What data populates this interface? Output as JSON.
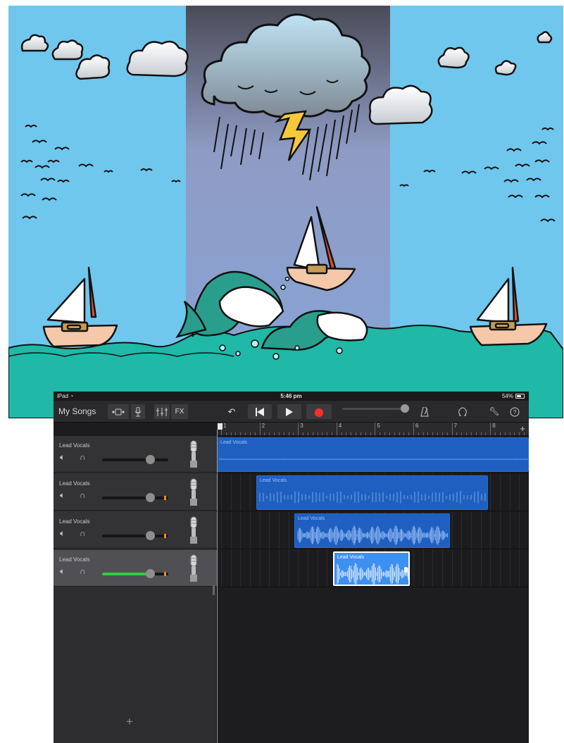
{
  "status_bar": {
    "device": "iPad",
    "wifi_icon": "wifi-icon",
    "time": "5:46 pm",
    "battery": "54%"
  },
  "toolbar": {
    "my_songs": "My Songs",
    "fx": "FX",
    "icons": [
      "browser-icon",
      "microphone-icon",
      "mixer-icon",
      "undo-icon",
      "rewind-icon",
      "play-icon",
      "record-icon",
      "metronome-icon",
      "loop-icon",
      "settings-wrench-icon",
      "help-icon"
    ]
  },
  "ruler": {
    "bars": [
      "1",
      "2",
      "3",
      "4",
      "5",
      "6",
      "7",
      "8"
    ],
    "add_label": "+"
  },
  "tracks": [
    {
      "name": "Lead Vocals",
      "volume": 0.72,
      "selected": false,
      "meter": false
    },
    {
      "name": "Lead Vocals",
      "volume": 0.72,
      "selected": false,
      "meter": true
    },
    {
      "name": "Lead Vocals",
      "volume": 0.72,
      "selected": false,
      "meter": true
    },
    {
      "name": "Lead Vocals",
      "volume": 0.72,
      "selected": true,
      "meter": true
    }
  ],
  "regions": [
    {
      "label": "Lead Vocals",
      "selected": false
    },
    {
      "label": "Lead Vocals",
      "selected": false
    },
    {
      "label": "Lead Vocals",
      "selected": false
    },
    {
      "label": "Lead Vocals",
      "selected": true
    }
  ],
  "add_track": "+",
  "colors": {
    "sky": "#6fc7ee",
    "storm_sky": "#7f95c4",
    "sea": "#20b8a6",
    "record": "#ff2d2d",
    "region": "#1f5fbf",
    "region_selected": "#3d8ff0",
    "volume_fill": "#2ad03a"
  }
}
